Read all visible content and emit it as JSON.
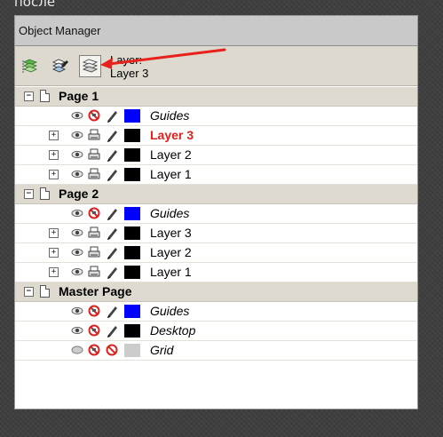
{
  "caption": "после",
  "panel": {
    "title": "Object Manager",
    "toolbar": {
      "layer_label": "Layer:",
      "current_layer": "Layer 3",
      "buttons": [
        "show-properties",
        "edit-across-layers",
        "layer-manager-view"
      ],
      "annotation_arrow_color": "#e8211d"
    }
  },
  "tree": {
    "pages": [
      {
        "name": "Page 1",
        "expanded": true,
        "layers": [
          {
            "name": "Guides",
            "style": "italic",
            "expander": false,
            "print": "no-print",
            "color": "#0000ff"
          },
          {
            "name": "Layer 3",
            "style": "active",
            "expander": true,
            "print": "printer",
            "color": "#000000"
          },
          {
            "name": "Layer 2",
            "style": "normal",
            "expander": true,
            "print": "printer",
            "color": "#000000"
          },
          {
            "name": "Layer 1",
            "style": "normal",
            "expander": true,
            "print": "printer",
            "color": "#000000"
          }
        ]
      },
      {
        "name": "Page 2",
        "expanded": true,
        "layers": [
          {
            "name": "Guides",
            "style": "italic",
            "expander": false,
            "print": "no-print",
            "color": "#0000ff"
          },
          {
            "name": "Layer 3",
            "style": "normal",
            "expander": true,
            "print": "printer",
            "color": "#000000"
          },
          {
            "name": "Layer 2",
            "style": "normal",
            "expander": true,
            "print": "printer",
            "color": "#000000"
          },
          {
            "name": "Layer 1",
            "style": "normal",
            "expander": true,
            "print": "printer",
            "color": "#000000"
          }
        ]
      },
      {
        "name": "Master Page",
        "expanded": true,
        "layers": [
          {
            "name": "Guides",
            "style": "italic",
            "expander": false,
            "print": "no-print",
            "color": "#0000ff"
          },
          {
            "name": "Desktop",
            "style": "italic",
            "expander": false,
            "print": "no-print",
            "color": "#000000"
          },
          {
            "name": "Grid",
            "style": "italic",
            "expander": false,
            "print": "no-print-grid",
            "color": "#cccccc"
          }
        ]
      }
    ]
  },
  "colors": {
    "active_layer": "#e0201c",
    "guides": "#0000ff",
    "no_print": "#d8231f"
  }
}
